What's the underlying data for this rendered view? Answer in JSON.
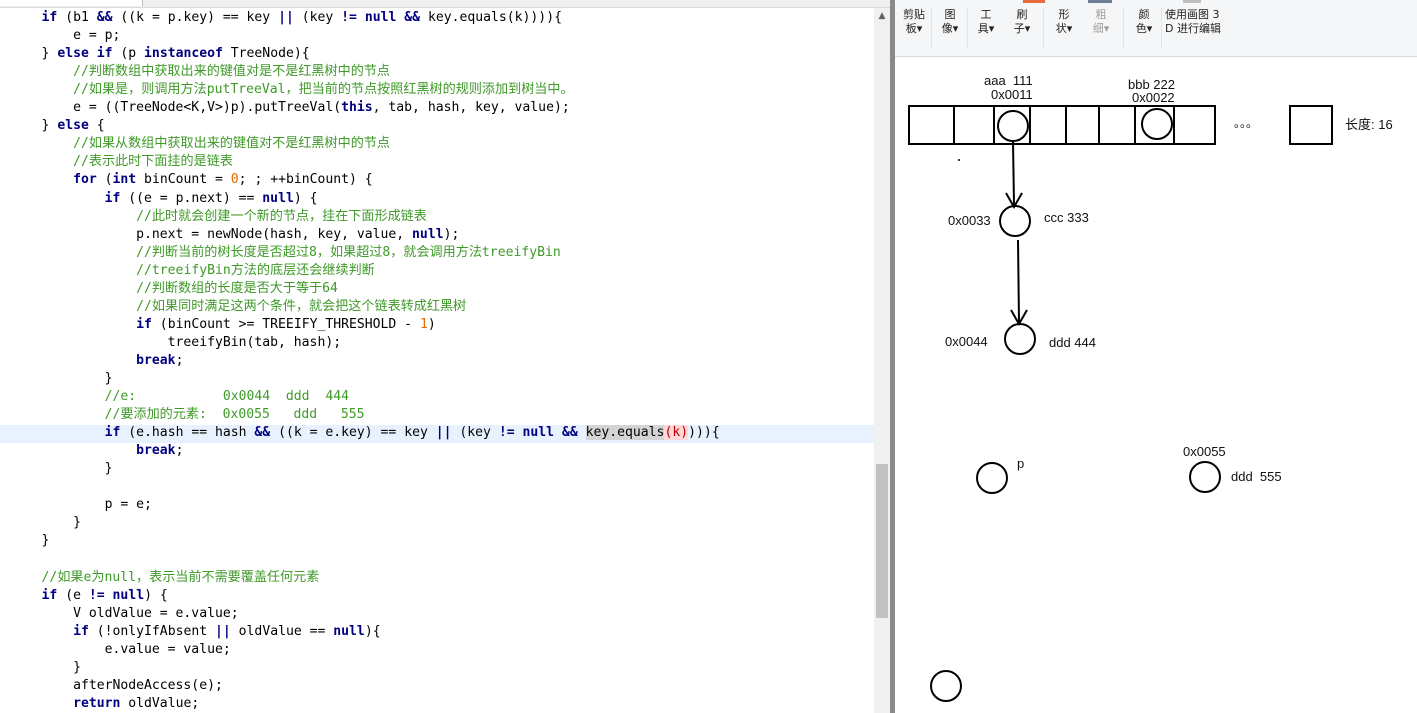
{
  "code": {
    "lines": [
      [
        {
          "t": "    "
        },
        {
          "t": "if",
          "c": "kw"
        },
        {
          "t": " (b1 "
        },
        {
          "t": "&&",
          "c": "kw"
        },
        {
          "t": " ((k = p.key) == key "
        },
        {
          "t": "||",
          "c": "kw"
        },
        {
          "t": " (key "
        },
        {
          "t": "!=",
          "c": "kw"
        },
        {
          "t": " "
        },
        {
          "t": "null",
          "c": "kw"
        },
        {
          "t": " "
        },
        {
          "t": "&&",
          "c": "kw"
        },
        {
          "t": " key.equals(k)))){"
        }
      ],
      [
        {
          "t": "        e = p;"
        }
      ],
      [
        {
          "t": "    } "
        },
        {
          "t": "else if",
          "c": "kw"
        },
        {
          "t": " (p "
        },
        {
          "t": "instanceof",
          "c": "kw"
        },
        {
          "t": " TreeNode){"
        }
      ],
      [
        {
          "t": "        "
        },
        {
          "t": "//判断数组中获取出来的键值对是不是红黑树中的节点",
          "c": "cm"
        }
      ],
      [
        {
          "t": "        "
        },
        {
          "t": "//如果是，则调用方法putTreeVal，把当前的节点按照红黑树的规则添加到树当中。",
          "c": "cm"
        }
      ],
      [
        {
          "t": "        e = ((TreeNode<K,V>)p).putTreeVal("
        },
        {
          "t": "this",
          "c": "kw"
        },
        {
          "t": ", tab, hash, key, value);"
        }
      ],
      [
        {
          "t": "    } "
        },
        {
          "t": "else",
          "c": "kw"
        },
        {
          "t": " {"
        }
      ],
      [
        {
          "t": "        "
        },
        {
          "t": "//如果从数组中获取出来的键值对不是红黑树中的节点",
          "c": "cm"
        }
      ],
      [
        {
          "t": "        "
        },
        {
          "t": "//表示此时下面挂的是链表",
          "c": "cm"
        }
      ],
      [
        {
          "t": "        "
        },
        {
          "t": "for",
          "c": "kw"
        },
        {
          "t": " ("
        },
        {
          "t": "int",
          "c": "kw"
        },
        {
          "t": " binCount = "
        },
        {
          "t": "0",
          "c": "nm"
        },
        {
          "t": "; ; ++binCount) {"
        }
      ],
      [
        {
          "t": "            "
        },
        {
          "t": "if",
          "c": "kw"
        },
        {
          "t": " ((e = p.next) == "
        },
        {
          "t": "null",
          "c": "kw"
        },
        {
          "t": ") {"
        }
      ],
      [
        {
          "t": "                "
        },
        {
          "t": "//此时就会创建一个新的节点，挂在下面形成链表",
          "c": "cm"
        }
      ],
      [
        {
          "t": "                p.next = newNode(hash, key, value, "
        },
        {
          "t": "null",
          "c": "kw"
        },
        {
          "t": ");"
        }
      ],
      [
        {
          "t": "                "
        },
        {
          "t": "//判断当前的树长度是否超过8，如果超过8，就会调用方法treeifyBin",
          "c": "cm"
        }
      ],
      [
        {
          "t": "                "
        },
        {
          "t": "//treeifyBin方法的底层还会继续判断",
          "c": "cm"
        }
      ],
      [
        {
          "t": "                "
        },
        {
          "t": "//判断数组的长度是否大于等于64",
          "c": "cm"
        }
      ],
      [
        {
          "t": "                "
        },
        {
          "t": "//如果同时满足这两个条件，就会把这个链表转成红黑树",
          "c": "cm"
        }
      ],
      [
        {
          "t": "                "
        },
        {
          "t": "if",
          "c": "kw"
        },
        {
          "t": " (binCount >= TREEIFY_THRESHOLD - "
        },
        {
          "t": "1",
          "c": "nm"
        },
        {
          "t": ")"
        }
      ],
      [
        {
          "t": "                    treeifyBin(tab, hash);"
        }
      ],
      [
        {
          "t": "                "
        },
        {
          "t": "break",
          "c": "kw"
        },
        {
          "t": ";"
        }
      ],
      [
        {
          "t": "            }"
        }
      ],
      [
        {
          "t": "            "
        },
        {
          "t": "//e:           0x0044  ddd  444",
          "c": "cm"
        }
      ],
      [
        {
          "t": "            "
        },
        {
          "t": "//要添加的元素:  0x0055   ddd   555",
          "c": "cm"
        }
      ],
      [
        {
          "t": "            "
        },
        {
          "t": "if",
          "c": "kw"
        },
        {
          "t": " (e.hash == hash "
        },
        {
          "t": "&&",
          "c": "kw"
        },
        {
          "t": " ((k = e.key) == key "
        },
        {
          "t": "||",
          "c": "kw"
        },
        {
          "t": " (key "
        },
        {
          "t": "!=",
          "c": "kw"
        },
        {
          "t": " "
        },
        {
          "t": "null",
          "c": "kw"
        },
        {
          "t": " "
        },
        {
          "t": "&&",
          "c": "kw"
        },
        {
          "t": " "
        },
        {
          "t": "key.equals",
          "c": "sel"
        },
        {
          "t": "(k)",
          "c": "caret-paren"
        },
        {
          "t": "))){"
        }
      ],
      [
        {
          "t": "                "
        },
        {
          "t": "break",
          "c": "kw"
        },
        {
          "t": ";"
        }
      ],
      [
        {
          "t": "            }"
        }
      ],
      [
        {
          "t": ""
        }
      ],
      [
        {
          "t": "            p = e;"
        }
      ],
      [
        {
          "t": "        }"
        }
      ],
      [
        {
          "t": "    }"
        }
      ],
      [
        {
          "t": ""
        }
      ],
      [
        {
          "t": "    "
        },
        {
          "t": "//如果e为null，表示当前不需要覆盖任何元素",
          "c": "cm"
        }
      ],
      [
        {
          "t": "    "
        },
        {
          "t": "if",
          "c": "kw"
        },
        {
          "t": " (e "
        },
        {
          "t": "!=",
          "c": "kw"
        },
        {
          "t": " "
        },
        {
          "t": "null",
          "c": "kw"
        },
        {
          "t": ") {"
        }
      ],
      [
        {
          "t": "        V oldValue = e.value;"
        }
      ],
      [
        {
          "t": "        "
        },
        {
          "t": "if",
          "c": "kw"
        },
        {
          "t": " (!onlyIfAbsent "
        },
        {
          "t": "||",
          "c": "kw"
        },
        {
          "t": " oldValue == "
        },
        {
          "t": "null",
          "c": "kw"
        },
        {
          "t": "){"
        }
      ],
      [
        {
          "t": "            e.value = value;"
        }
      ],
      [
        {
          "t": "        }"
        }
      ],
      [
        {
          "t": "        afterNodeAccess(e);"
        }
      ],
      [
        {
          "t": "        "
        },
        {
          "t": "return",
          "c": "kw"
        },
        {
          "t": " oldValue;"
        }
      ]
    ]
  },
  "ribbon": {
    "groups": [
      {
        "name": "clipboard",
        "line1": "剪贴",
        "line2": "板▾",
        "disabled": false
      },
      {
        "name": "image",
        "line1": "图",
        "line2": "像▾",
        "disabled": false
      },
      {
        "name": "tools",
        "line1": "工",
        "line2": "具▾",
        "disabled": false
      },
      {
        "name": "brushes",
        "line1": "刷",
        "line2": "子▾",
        "disabled": false
      },
      {
        "name": "shapes",
        "line1": "形",
        "line2": "状▾",
        "disabled": false
      },
      {
        "name": "outline",
        "line1": "粗",
        "line2": "细▾",
        "disabled": true
      },
      {
        "name": "colors",
        "line1": "颜",
        "line2": "色▾",
        "disabled": false
      },
      {
        "name": "paint3d",
        "line1": "使用画图 3",
        "line2": "D 进行编辑",
        "disabled": false
      }
    ]
  },
  "diagram": {
    "aaa_label": "aaa  111",
    "aaa_addr": "0x0011",
    "bbb_label": "bbb 222",
    "bbb_addr": "0x0022",
    "ellipsis": "。。。",
    "length_label": "长度: 16",
    "ccc_addr": "0x0033",
    "ccc_label": "ccc 333",
    "ddd444_addr": "0x0044",
    "ddd444_label": "ddd 444",
    "p_label": "p",
    "ddd555_addr": "0x0055",
    "ddd555_label": "ddd  555"
  },
  "colors": {
    "keyword": "#000080",
    "comment": "#3f9a28",
    "number": "#e06c00",
    "current_line": "#e8f2fe"
  }
}
